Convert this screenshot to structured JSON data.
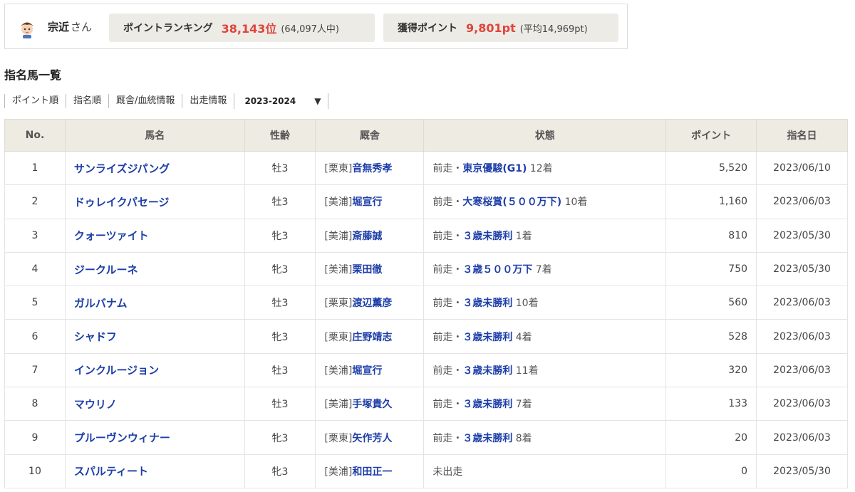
{
  "user": {
    "name": "宗近",
    "honorific": "さん"
  },
  "stats": {
    "ranking": {
      "label": "ポイントランキング",
      "value": "38,143位",
      "sub": "(64,097人中)"
    },
    "points": {
      "label": "獲得ポイント",
      "value": "9,801pt",
      "sub": "(平均14,969pt)"
    }
  },
  "section_title": "指名馬一覧",
  "tabs": [
    "ポイント順",
    "指名順",
    "厩舎/血統情報",
    "出走情報"
  ],
  "season_select": {
    "value": "2023-2024",
    "arrow": "▼"
  },
  "table": {
    "headers": [
      "No.",
      "馬名",
      "性齢",
      "厩舎",
      "状態",
      "ポイント",
      "指名日"
    ],
    "rows": [
      {
        "no": "1",
        "name": "サンライズジパング",
        "sex": "牡3",
        "region": "[栗東]",
        "trainer": "音無秀孝",
        "prefix": "前走・",
        "race": "東京優駿(G1)",
        "result": " 12着",
        "points": "5,520",
        "date": "2023/06/10"
      },
      {
        "no": "2",
        "name": "ドゥレイクパセージ",
        "sex": "牡3",
        "region": "[美浦]",
        "trainer": "堀宣行",
        "prefix": "前走・",
        "race": "大寒桜賞(５００万下)",
        "result": " 10着",
        "points": "1,160",
        "date": "2023/06/03"
      },
      {
        "no": "3",
        "name": "クォーツァイト",
        "sex": "牝3",
        "region": "[美浦]",
        "trainer": "斎藤誠",
        "prefix": "前走・",
        "race": "３歳未勝利",
        "result": " 1着",
        "points": "810",
        "date": "2023/05/30"
      },
      {
        "no": "4",
        "name": "ジークルーネ",
        "sex": "牝3",
        "region": "[美浦]",
        "trainer": "栗田徹",
        "prefix": "前走・",
        "race": "３歳５００万下",
        "result": " 7着",
        "points": "750",
        "date": "2023/05/30"
      },
      {
        "no": "5",
        "name": "ガルバナム",
        "sex": "牡3",
        "region": "[栗東]",
        "trainer": "渡辺薫彦",
        "prefix": "前走・",
        "race": "３歳未勝利",
        "result": " 10着",
        "points": "560",
        "date": "2023/06/03"
      },
      {
        "no": "6",
        "name": "シャドフ",
        "sex": "牝3",
        "region": "[栗東]",
        "trainer": "庄野靖志",
        "prefix": "前走・",
        "race": "３歳未勝利",
        "result": " 4着",
        "points": "528",
        "date": "2023/06/03"
      },
      {
        "no": "7",
        "name": "インクルージョン",
        "sex": "牡3",
        "region": "[美浦]",
        "trainer": "堀宣行",
        "prefix": "前走・",
        "race": "３歳未勝利",
        "result": " 11着",
        "points": "320",
        "date": "2023/06/03"
      },
      {
        "no": "8",
        "name": "マウリノ",
        "sex": "牡3",
        "region": "[美浦]",
        "trainer": "手塚貴久",
        "prefix": "前走・",
        "race": "３歳未勝利",
        "result": " 7着",
        "points": "133",
        "date": "2023/06/03"
      },
      {
        "no": "9",
        "name": "プルーヴンウィナー",
        "sex": "牝3",
        "region": "[栗東]",
        "trainer": "矢作芳人",
        "prefix": "前走・",
        "race": "３歳未勝利",
        "result": " 8着",
        "points": "20",
        "date": "2023/06/03"
      },
      {
        "no": "10",
        "name": "スパルティート",
        "sex": "牝3",
        "region": "[美浦]",
        "trainer": "和田正一",
        "prefix": "未出走",
        "race": "",
        "result": "",
        "points": "0",
        "date": "2023/05/30"
      }
    ]
  },
  "colors": {
    "accent_red": "#e0443a",
    "link_blue": "#1d3ea8",
    "header_bg": "#eeebe2",
    "stat_bg": "#ecebe6"
  },
  "icons": {
    "avatar": "user-avatar-icon",
    "dropdown": "chevron-down-icon"
  }
}
